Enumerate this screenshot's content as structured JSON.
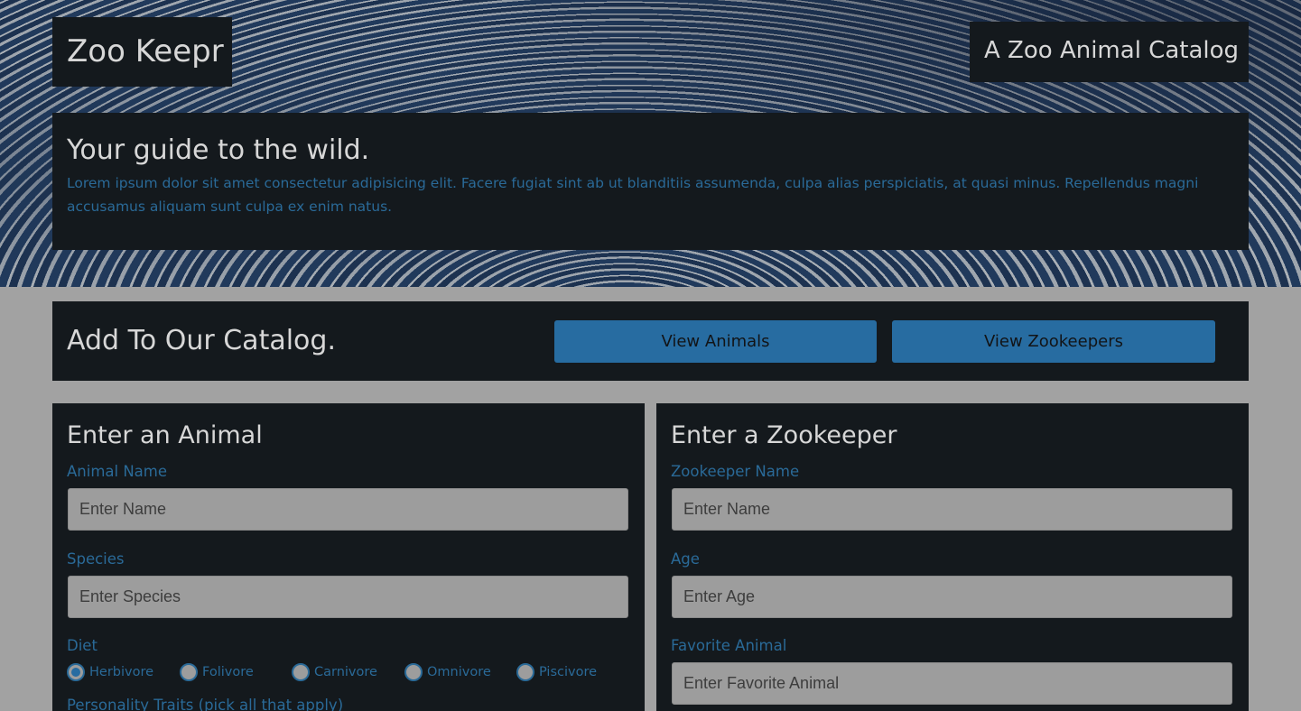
{
  "header": {
    "brand": "Zoo Keepr",
    "tagline": "A Zoo Animal Catalog"
  },
  "jumbotron": {
    "heading": "Your guide to the wild.",
    "text": "Lorem ipsum dolor sit amet consectetur adipisicing elit. Facere fugiat sint ab ut blanditiis assumenda, culpa alias perspiciatis, at quasi minus. Repellendus magni accusamus aliquam sunt culpa ex enim natus."
  },
  "catalog": {
    "heading": "Add To Our Catalog.",
    "view_animals_label": "View Animals",
    "view_zookeepers_label": "View Zookeepers"
  },
  "animal_form": {
    "heading": "Enter an Animal",
    "name_label": "Animal Name",
    "name_placeholder": "Enter Name",
    "species_label": "Species",
    "species_placeholder": "Enter Species",
    "diet_label": "Diet",
    "diet_options": [
      "Herbivore",
      "Folivore",
      "Carnivore",
      "Omnivore",
      "Piscivore"
    ],
    "diet_selected": "Herbivore",
    "traits_label": "Personality Traits (pick all that apply)"
  },
  "zookeeper_form": {
    "heading": "Enter a Zookeeper",
    "name_label": "Zookeeper Name",
    "name_placeholder": "Enter Name",
    "age_label": "Age",
    "age_placeholder": "Enter Age",
    "favorite_label": "Favorite Animal",
    "favorite_placeholder": "Enter Favorite Animal"
  },
  "colors": {
    "accent": "#276ca1",
    "panel": "#14191d",
    "page_background": "#a2a2a2"
  }
}
